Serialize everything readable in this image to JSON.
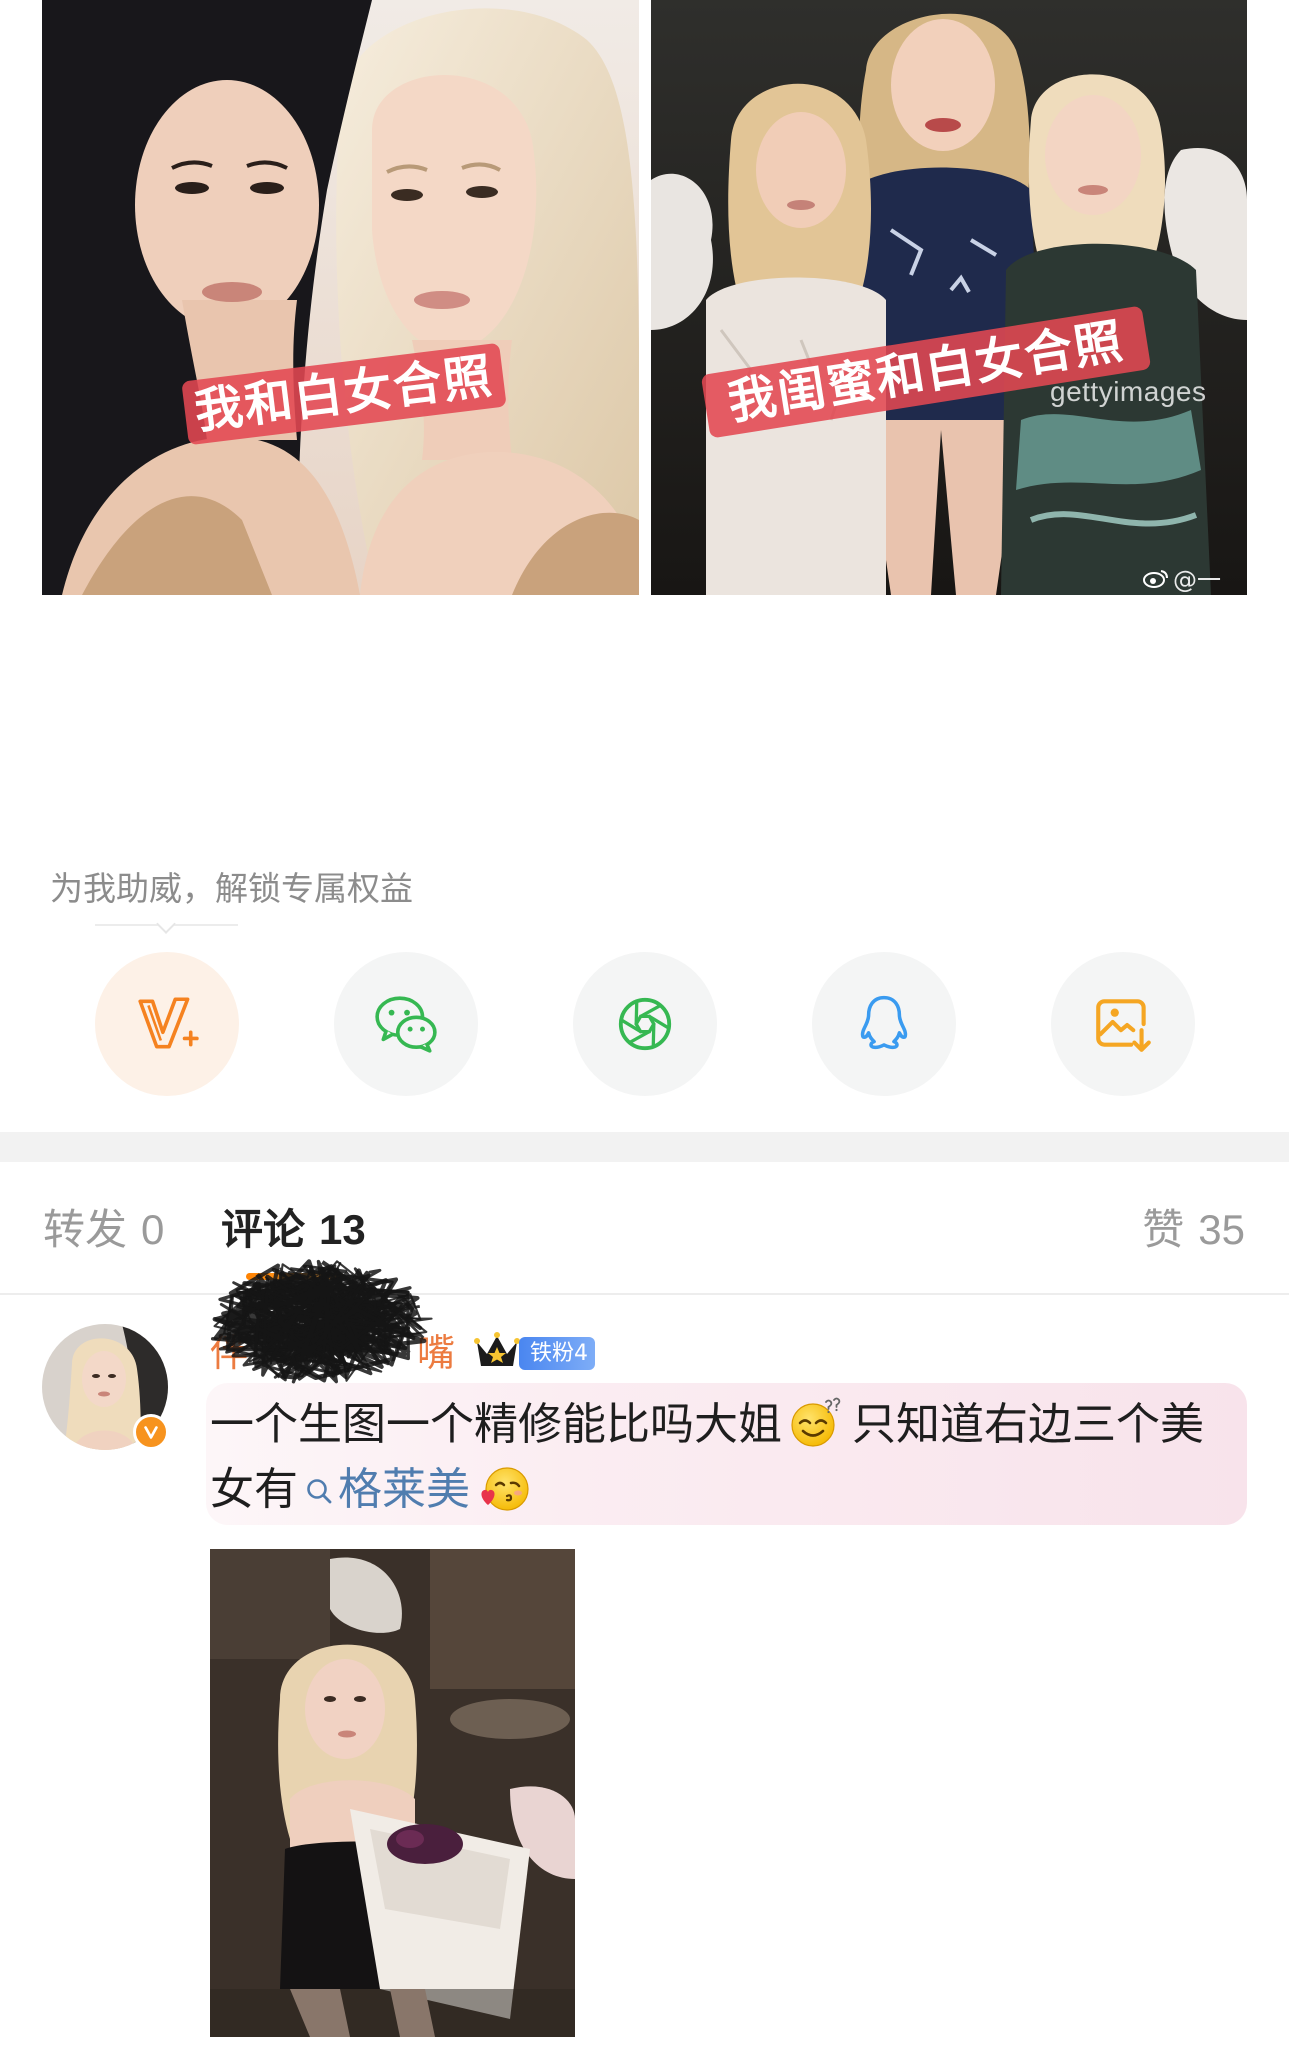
{
  "post": {
    "images": [
      {
        "overlay_label": "我和白女合照"
      },
      {
        "overlay_label": "我闺蜜和白女合照",
        "watermark": "gettyimages",
        "credit": "@一"
      }
    ]
  },
  "support": {
    "prompt": "为我助威，解锁专属权益"
  },
  "share_actions": [
    {
      "icon": "vip-plus-icon"
    },
    {
      "icon": "wechat-icon"
    },
    {
      "icon": "moments-icon"
    },
    {
      "icon": "qq-icon"
    },
    {
      "icon": "save-image-icon"
    }
  ],
  "tabs": {
    "repost": {
      "label": "转发",
      "count": "0"
    },
    "comments": {
      "label": "评论",
      "count": "13",
      "active": true
    },
    "likes": {
      "label": "赞",
      "count": "35"
    }
  },
  "comment": {
    "username_start": "伴",
    "username_end": "嘴",
    "crown_icon": "crown-icon",
    "fan_badge": "铁粉4",
    "verified": true,
    "text_part1": "一个生图一个精修能比吗大姐",
    "emoji1": "squinting-question-emoji",
    "text_part2": "只知道右边三个美女有",
    "search_topic": "格莱美",
    "emoji2": "blowing-kiss-emoji"
  },
  "colors": {
    "accent": "#ff8200",
    "username": "#ec7b40",
    "link": "#507daf",
    "fan_badge": "#4a86f0",
    "muted_text": "#9a9a9a",
    "verified": "#f7931e",
    "wechat_green": "#36b852",
    "qq_blue": "#3a9bf0"
  }
}
